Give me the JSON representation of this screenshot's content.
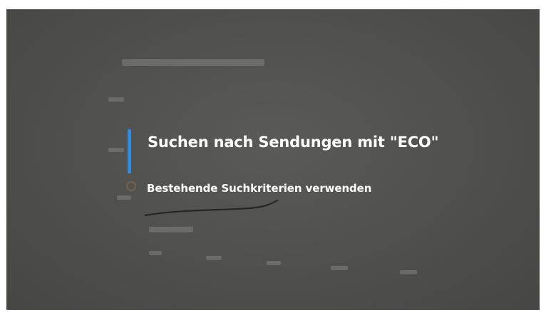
{
  "menu": {
    "title": "Suchen nach Sendungen mit \"ECO\"",
    "subtitle": "Bestehende Suchkriterien verwenden"
  },
  "colors": {
    "focus_accent": "#2f8be0",
    "screen_background": "#53534f",
    "text": "#ffffff"
  }
}
